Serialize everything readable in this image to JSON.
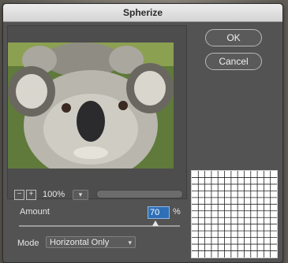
{
  "dialog": {
    "title": "Spherize"
  },
  "buttons": {
    "ok": "OK",
    "cancel": "Cancel"
  },
  "zoom": {
    "minus": "−",
    "plus": "+",
    "value": "100%",
    "dropdown_icon": "chevron-down-icon"
  },
  "amount": {
    "label": "Amount",
    "value": "70",
    "unit": "%",
    "slider_fraction": 0.85
  },
  "mode": {
    "label": "Mode",
    "selected": "Horizontal Only"
  },
  "colors": {
    "dialog_bg": "#535353",
    "input_highlight": "#2f6fb6"
  }
}
